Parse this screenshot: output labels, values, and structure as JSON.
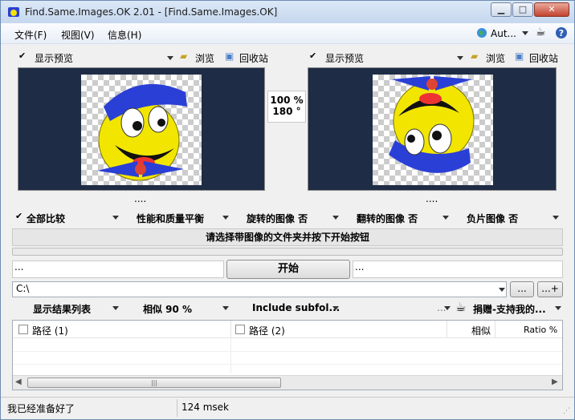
{
  "window": {
    "title": "Find.Same.Images.OK 2.01 - [Find.Same.Images.OK]"
  },
  "menu": {
    "file": "文件(F)",
    "view": "视图(V)",
    "info": "信息(H)",
    "language": "Aut..."
  },
  "left_panel": {
    "preview_label": "显示预览",
    "browse": "浏览",
    "recycle": "回收站"
  },
  "right_panel": {
    "preview_label": "显示预览",
    "browse": "浏览",
    "recycle": "回收站"
  },
  "center_info": {
    "zoom": "100 %",
    "rotation": "180 °"
  },
  "dots_left": "....",
  "dots_right": "....",
  "options": {
    "compare_all": "全部比较",
    "performance": "性能和质量平衡",
    "rotated": "旋转的图像 否",
    "flipped": "翻转的图像 否",
    "negative": "负片图像 否"
  },
  "instruction": "请选择带图像的文件夹并按下开始按钮",
  "start_row": {
    "left_dots": "...",
    "start_label": "开始",
    "right_dots": "..."
  },
  "path": {
    "value": "C:\\",
    "browse_btn": "...",
    "add_btn": "...+"
  },
  "results_bar": {
    "show_list": "显示结果列表",
    "similarity": "相似 90 %",
    "include_subfolders": "Include subfol...",
    "more": "...",
    "donate": "捐赠-支持我的..."
  },
  "table": {
    "col_path1": "路径 (1)",
    "col_path2": "路径 (2)",
    "col_similar": "相似",
    "col_ratio": "Ratio %"
  },
  "status": {
    "message": "我已经准备好了",
    "time": "124 msek"
  },
  "colors": {
    "preview_bg": "#1e2c45",
    "smiley_yellow": "#f2e600",
    "hat_blue": "#2a3fd6"
  }
}
